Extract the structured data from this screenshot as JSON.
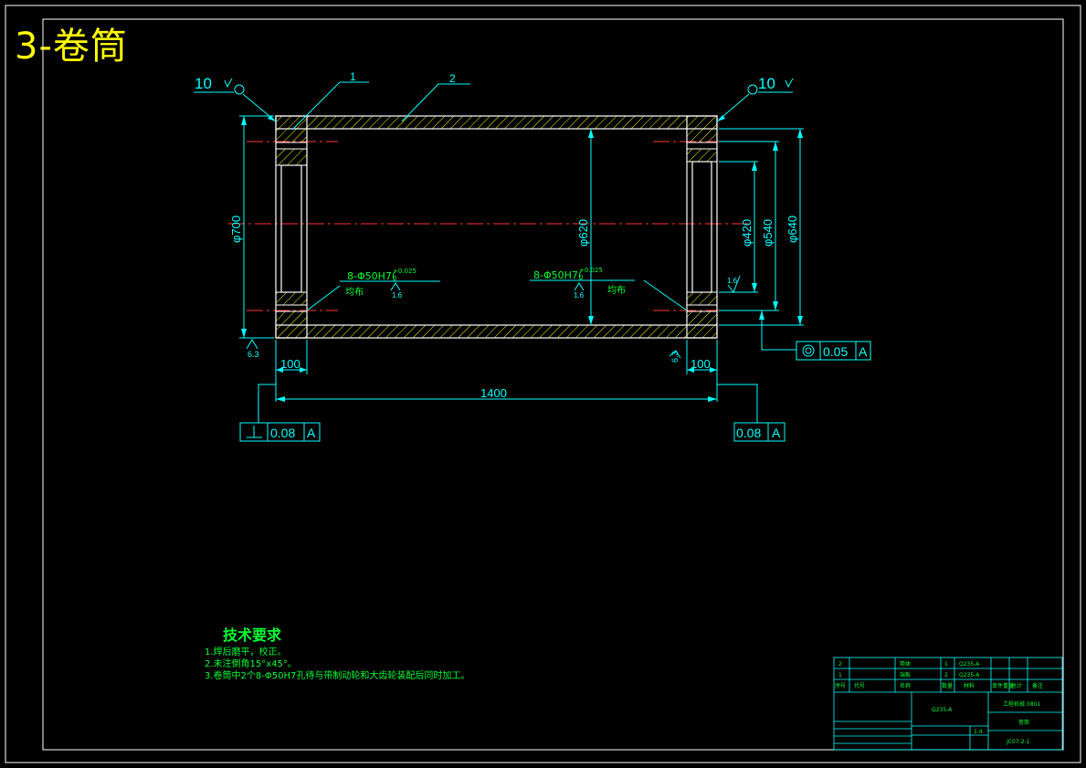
{
  "title": "3-卷筒",
  "dimensions": {
    "d700": "φ700",
    "d620": "φ620",
    "d420": "φ420",
    "d540": "φ540",
    "d640": "φ640",
    "len1400": "1400",
    "w_left": "100",
    "w_right": "100"
  },
  "roughness": {
    "left_top": "10",
    "right_top": "10",
    "r63_left": "6.3",
    "r63_right": "6.3",
    "r16_a": "1.6",
    "r16_b": "1.6",
    "r16_c": "1.6"
  },
  "part_labels": {
    "p1": "1",
    "p2": "2"
  },
  "holes": {
    "left": "8-Φ50H7(",
    "right": "8-Φ50H7(",
    "tol_upper": "+0.025",
    "tol_lower": "0",
    "even_left": "均布",
    "even_right": "均布"
  },
  "tolerance_frames": {
    "coax": {
      "value": "0.05",
      "datum": "A"
    },
    "perp_left": {
      "value": "0.08",
      "datum": "A"
    },
    "right": {
      "value": "0.08",
      "datum": "A"
    }
  },
  "notes": {
    "title": "技术要求",
    "lines": [
      "1.焊后磨平，校正。",
      "2.未注倒角15°x45°。",
      "3.卷筒中2个8-Φ50H7孔待与带制动轮和大齿轮装配后同时加工。"
    ]
  },
  "title_block": {
    "row1": [
      "2",
      "",
      "筒体",
      "1",
      "Q235-A"
    ],
    "row2": [
      "1",
      "",
      "端板",
      "2",
      "Q235-A"
    ],
    "header": [
      "序号",
      "代号",
      "名称",
      "数量",
      "材料",
      "单件重量",
      "总计",
      "备注"
    ],
    "material": "Q235-A",
    "company": "工程机械 0801",
    "part_name": "卷筒",
    "drawing_no": "JC07-2-1",
    "scale": "1:4"
  },
  "colors": {
    "background": "#000000",
    "border": "#ffffff",
    "outline": "#ffffff",
    "dimension": "#00ffff",
    "hatch": "#ffff00",
    "centerline": "#ff3333",
    "text_green": "#00ff33",
    "title": "#ffff00"
  }
}
